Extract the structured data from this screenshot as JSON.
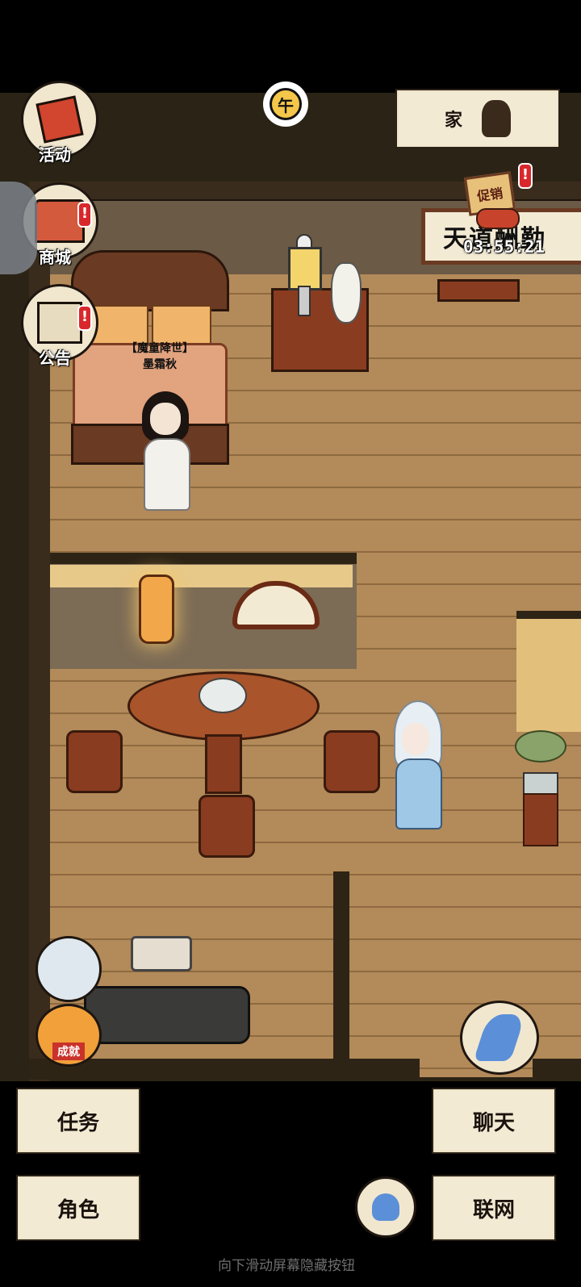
{
  "sun": {
    "time_glyph": "午"
  },
  "location": {
    "label": "家"
  },
  "side_menu": [
    {
      "id": "activity",
      "label": "活动"
    },
    {
      "id": "shop",
      "label": "商城"
    },
    {
      "id": "notice",
      "label": "公告"
    }
  ],
  "promo": {
    "sign": "促销",
    "timer": "03:55:21"
  },
  "scroll_banner": {
    "text": "天道酬勤"
  },
  "npc": {
    "title": "【魔童降世】",
    "name": "墨霜秋"
  },
  "achievement": {
    "label": "成就"
  },
  "buttons": {
    "task": "任务",
    "chat": "聊天",
    "role": "角色",
    "network": "联网"
  },
  "footer_hint": "向下滑动屏幕隐藏按钮",
  "colors": {
    "badge_red": "#d8282c",
    "paper": "#f3ead4",
    "wood": "#b38a59"
  }
}
